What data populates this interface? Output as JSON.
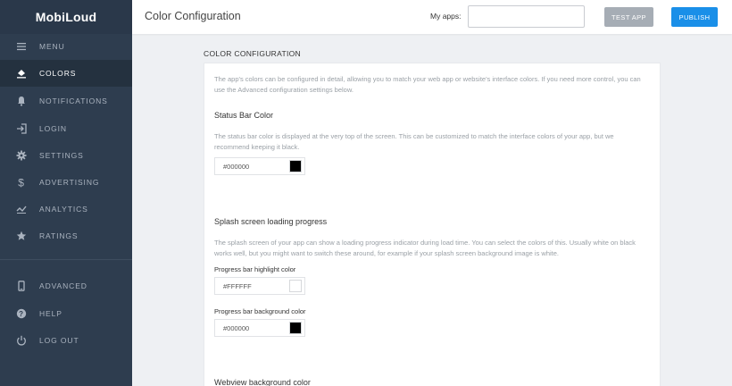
{
  "brand": {
    "name": "MobiLoud"
  },
  "sidebar": {
    "items": [
      {
        "label": "MENU",
        "icon": "hamburger-icon",
        "active": false
      },
      {
        "label": "COLORS",
        "icon": "paint-bucket-icon",
        "active": true
      },
      {
        "label": "NOTIFICATIONS",
        "icon": "bell-icon",
        "active": false
      },
      {
        "label": "LOGIN",
        "icon": "sign-in-icon",
        "active": false
      },
      {
        "label": "SETTINGS",
        "icon": "gear-icon",
        "active": false
      },
      {
        "label": "ADVERTISING",
        "icon": "dollar-icon",
        "active": false
      },
      {
        "label": "ANALYTICS",
        "icon": "analytics-icon",
        "active": false
      },
      {
        "label": "RATINGS",
        "icon": "star-icon",
        "active": false
      }
    ],
    "bottom_items": [
      {
        "label": "ADVANCED",
        "icon": "mobile-icon"
      },
      {
        "label": "HELP",
        "icon": "question-icon"
      },
      {
        "label": "LOG OUT",
        "icon": "power-icon"
      }
    ]
  },
  "header": {
    "title": "Color Configuration",
    "myapps_label": "My apps:",
    "myapps_value": "",
    "test_app_label": "TEST APP",
    "publish_label": "PUBLISH"
  },
  "main": {
    "section_title": "COLOR CONFIGURATION",
    "intro": "The app's colors can be configured in detail, allowing you to match your web app or website's interface colors. If you need more control, you can use the Advanced configuration settings below.",
    "status_bar": {
      "title": "Status Bar Color",
      "desc": "The status bar color is displayed at the very top of the screen. This can be customized to match the interface colors of your app, but we recommend keeping it black.",
      "value": "#000000",
      "swatch": "#000000"
    },
    "splash": {
      "title": "Splash screen loading progress",
      "desc": "The splash screen of your app can show a loading progress indicator during load time. You can select the colors of this. Usually white on black works well, but you might want to switch these around, for example if your splash screen background image is white.",
      "highlight_label": "Progress bar highlight color",
      "highlight_value": "#FFFFFF",
      "highlight_swatch": "#FFFFFF",
      "background_label": "Progress bar background color",
      "background_value": "#000000",
      "background_swatch": "#000000"
    },
    "webview": {
      "title": "Webview background color"
    }
  },
  "colors": {
    "sidebar_bg": "#2e3d4f",
    "active_item_bg": "#24313f",
    "publish_blue": "#1a8fe8",
    "test_app_gray": "#a6adb5"
  }
}
